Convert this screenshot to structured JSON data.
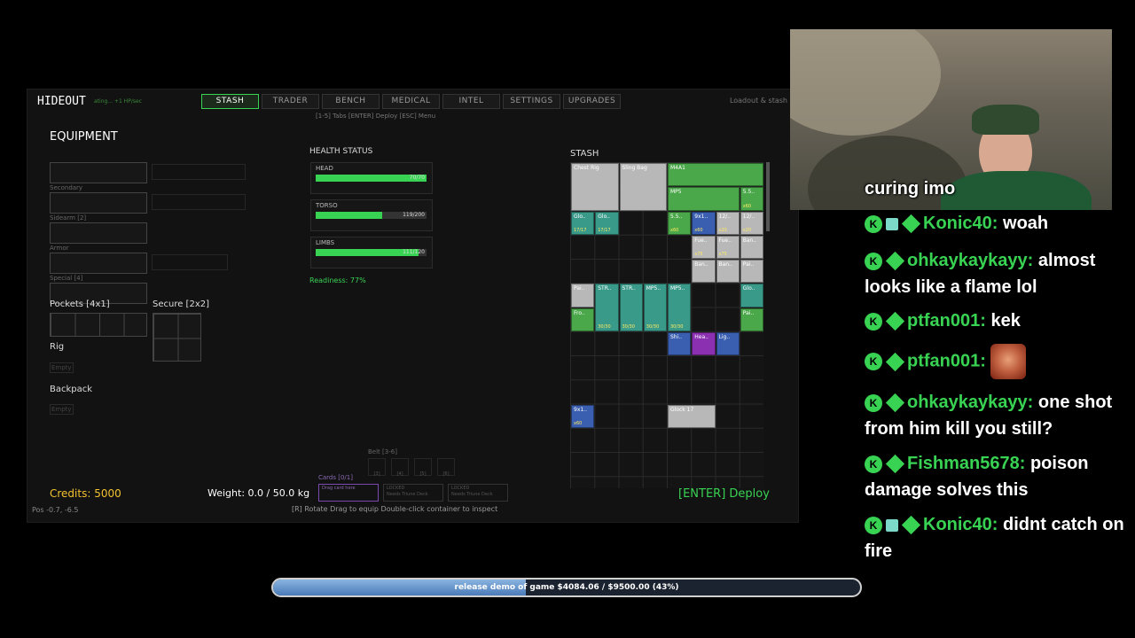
{
  "game": {
    "title": "HIDEOUT",
    "subtitle": "ating... +1 HP/sec",
    "tabs": [
      "STASH",
      "TRADER",
      "BENCH",
      "MEDICAL",
      "INTEL",
      "SETTINGS",
      "UPGRADES"
    ],
    "active_tab": "STASH",
    "top_right_hint": "Loadout & stash",
    "key_hint": "[1-5] Tabs  [ENTER] Deploy  [ESC] Menu",
    "equipment": {
      "heading": "EQUIPMENT",
      "slot_labels": [
        "Secondary",
        "Sidearm [2]",
        "Armor",
        "Special [4]"
      ],
      "pockets_label": "Pockets [4x1]",
      "secure_label": "Secure [2x2]",
      "rig_label": "Rig",
      "rig_value": "Empty",
      "backpack_label": "Backpack",
      "backpack_value": "Empty"
    },
    "health": {
      "heading": "HEALTH STATUS",
      "parts": [
        {
          "label": "HEAD",
          "value": "70/70",
          "fraction": 1.0
        },
        {
          "label": "TORSO",
          "value": "119/200",
          "fraction": 0.6
        },
        {
          "label": "LIMBS",
          "value": "111/120",
          "fraction": 0.93
        }
      ],
      "readiness": "Readiness: 77%"
    },
    "stash": {
      "heading": "STASH",
      "items": [
        {
          "label": "Chest Rig",
          "color": "gray",
          "count": ""
        },
        {
          "label": "Sling Bag",
          "color": "gray",
          "count": ""
        },
        {
          "label": "M4A1",
          "color": "green",
          "count": ""
        },
        {
          "label": "MP5",
          "color": "green",
          "count": ""
        },
        {
          "label": "5.5..",
          "color": "green",
          "count": "x60"
        },
        {
          "label": "Glo..",
          "color": "teal",
          "count": "17/17"
        },
        {
          "label": "Glo..",
          "color": "teal",
          "count": "17/17"
        },
        {
          "label": "5.5..",
          "color": "green",
          "count": "x60"
        },
        {
          "label": "9x1..",
          "color": "blue",
          "count": "x60"
        },
        {
          "label": "12/..",
          "color": "gray",
          "count": "x20"
        },
        {
          "label": "12/..",
          "color": "gray",
          "count": "x20"
        },
        {
          "label": "Fue..",
          "color": "gray",
          "count": "x75"
        },
        {
          "label": "Fue..",
          "color": "gray",
          "count": "x75"
        },
        {
          "label": "Ban..",
          "color": "gray",
          "count": ""
        },
        {
          "label": "Ban..",
          "color": "gray",
          "count": ""
        },
        {
          "label": "Ban..",
          "color": "gray",
          "count": ""
        },
        {
          "label": "Pai..",
          "color": "gray",
          "count": ""
        },
        {
          "label": "Pai..",
          "color": "gray",
          "count": ""
        },
        {
          "label": "STR..",
          "color": "teal",
          "count": "30/30"
        },
        {
          "label": "STR..",
          "color": "teal",
          "count": "30/30"
        },
        {
          "label": "MP5..",
          "color": "teal",
          "count": "30/30"
        },
        {
          "label": "MP5..",
          "color": "teal",
          "count": "30/30"
        },
        {
          "label": "Glo..",
          "color": "teal",
          "count": ""
        },
        {
          "label": "Fro..",
          "color": "green",
          "count": ""
        },
        {
          "label": "Pai..",
          "color": "green",
          "count": ""
        },
        {
          "label": "Shi..",
          "color": "blue",
          "count": ""
        },
        {
          "label": "Hea..",
          "color": "purple",
          "count": ""
        },
        {
          "label": "Lig..",
          "color": "blue",
          "count": ""
        },
        {
          "label": "9x1..",
          "color": "blue",
          "count": "x60"
        },
        {
          "label": "Glock 17",
          "color": "gray",
          "count": ""
        }
      ]
    },
    "belt_label": "Belt [3-6]",
    "belt_slots": [
      "[3]",
      "[4]",
      "[5]",
      "[6]"
    ],
    "cards_label": "Cards [0/1]",
    "cards": [
      {
        "line1": "Drag card here",
        "line2": ""
      },
      {
        "line1": "LOCKED",
        "line2": "Needs Triune Deck"
      },
      {
        "line1": "LOCKED",
        "line2": "Needs Triune Deck"
      }
    ],
    "credits": "Credits: 5000",
    "weight": "Weight: 0.0 / 50.0 kg",
    "deploy": "[ENTER] Deploy",
    "pos": "Pos -0.7, -6.5",
    "controls": "[R] Rotate     Drag to equip     Double-click container to inspect"
  },
  "chat": {
    "messages": [
      {
        "user": "",
        "text": "curing imo",
        "gift": false,
        "emote": false
      },
      {
        "user": "Konic40:",
        "text": "woah",
        "gift": true,
        "emote": false
      },
      {
        "user": "ohkaykaykayy:",
        "text": "almost looks like a flame lol",
        "gift": false,
        "emote": false
      },
      {
        "user": "ptfan001:",
        "text": "kek",
        "gift": false,
        "emote": false
      },
      {
        "user": "ptfan001:",
        "text": "",
        "gift": false,
        "emote": true
      },
      {
        "user": "ohkaykaykayy:",
        "text": "one shot from him kill you still?",
        "gift": false,
        "emote": false
      },
      {
        "user": "Fishman5678:",
        "text": "poison damage solves this",
        "gift": false,
        "emote": false
      },
      {
        "user": "Konic40:",
        "text": "didnt catch on fire",
        "gift": true,
        "emote": false
      }
    ]
  },
  "goal": {
    "text": "release demo of game $4084.06 / $9500.00 (43%)",
    "fraction": 0.43
  },
  "colors": {
    "accent_green": "#39d353",
    "credits_gold": "#f2c230",
    "goal_blue": "#4a7ab8"
  }
}
